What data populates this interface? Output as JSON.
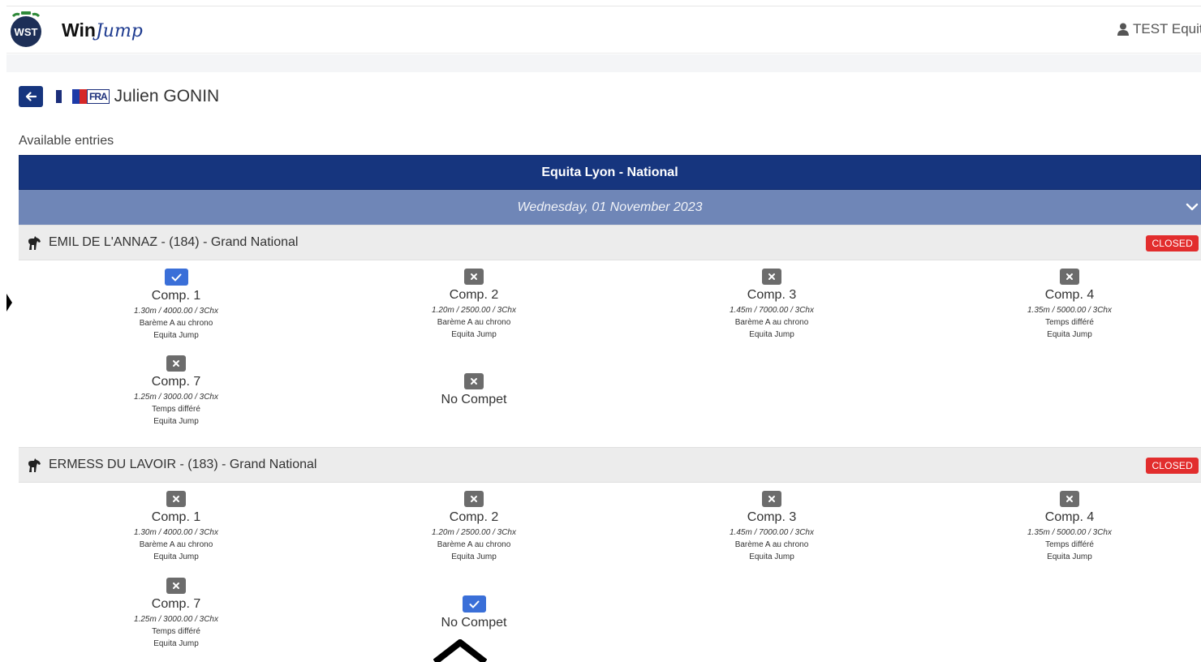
{
  "app": {
    "logo_text": "WST",
    "brand_win": "Win",
    "brand_jump": "Jump",
    "user_label": "TEST Equita"
  },
  "rider": {
    "country_code": "FRA",
    "name": "Julien GONIN"
  },
  "section_title": "Available entries",
  "event": {
    "title": "Equita Lyon - National",
    "date": "Wednesday, 01 November 2023"
  },
  "horses": [
    {
      "name": "EMIL DE L'ANNAZ - (184) - Grand National",
      "status": "CLOSED",
      "comps": [
        {
          "title": "Comp. 1",
          "spec": "1.30m / 4000.00 / 3Chx",
          "rule": "Barème A au chrono",
          "org": "Equita Jump",
          "checked": true
        },
        {
          "title": "Comp. 2",
          "spec": "1.20m / 2500.00 / 3Chx",
          "rule": "Barème A au chrono",
          "org": "Equita Jump",
          "checked": false
        },
        {
          "title": "Comp. 3",
          "spec": "1.45m / 7000.00 / 3Chx",
          "rule": "Barème A au chrono",
          "org": "Equita Jump",
          "checked": false
        },
        {
          "title": "Comp. 4",
          "spec": "1.35m / 5000.00 / 3Chx",
          "rule": "Temps différé",
          "org": "Equita Jump",
          "checked": false
        },
        {
          "title": "Comp. 7",
          "spec": "1.25m / 3000.00 / 3Chx",
          "rule": "Temps différé",
          "org": "Equita Jump",
          "checked": false
        },
        {
          "title": "No Compet",
          "checked": false
        }
      ]
    },
    {
      "name": "ERMESS DU LAVOIR - (183) - Grand National",
      "status": "CLOSED",
      "comps": [
        {
          "title": "Comp. 1",
          "spec": "1.30m / 4000.00 / 3Chx",
          "rule": "Barème A au chrono",
          "org": "Equita Jump",
          "checked": false
        },
        {
          "title": "Comp. 2",
          "spec": "1.20m / 2500.00 / 3Chx",
          "rule": "Barème A au chrono",
          "org": "Equita Jump",
          "checked": false
        },
        {
          "title": "Comp. 3",
          "spec": "1.45m / 7000.00 / 3Chx",
          "rule": "Barème A au chrono",
          "org": "Equita Jump",
          "checked": false
        },
        {
          "title": "Comp. 4",
          "spec": "1.35m / 5000.00 / 3Chx",
          "rule": "Temps différé",
          "org": "Equita Jump",
          "checked": false
        },
        {
          "title": "Comp. 7",
          "spec": "1.25m / 3000.00 / 3Chx",
          "rule": "Temps différé",
          "org": "Equita Jump",
          "checked": false
        },
        {
          "title": "No Compet",
          "checked": true
        }
      ]
    }
  ],
  "icons": {
    "back": "arrow-left-icon",
    "user": "user-icon",
    "horse": "horse-icon",
    "expand": "chevron-down-icon",
    "checked": "check-icon",
    "unchecked": "x-icon"
  },
  "colors": {
    "primary": "#16357e",
    "date_band": "#6f86b7",
    "checked": "#3a6fd8",
    "unchecked": "#6c6c6c",
    "closed": "#e22d2d"
  }
}
